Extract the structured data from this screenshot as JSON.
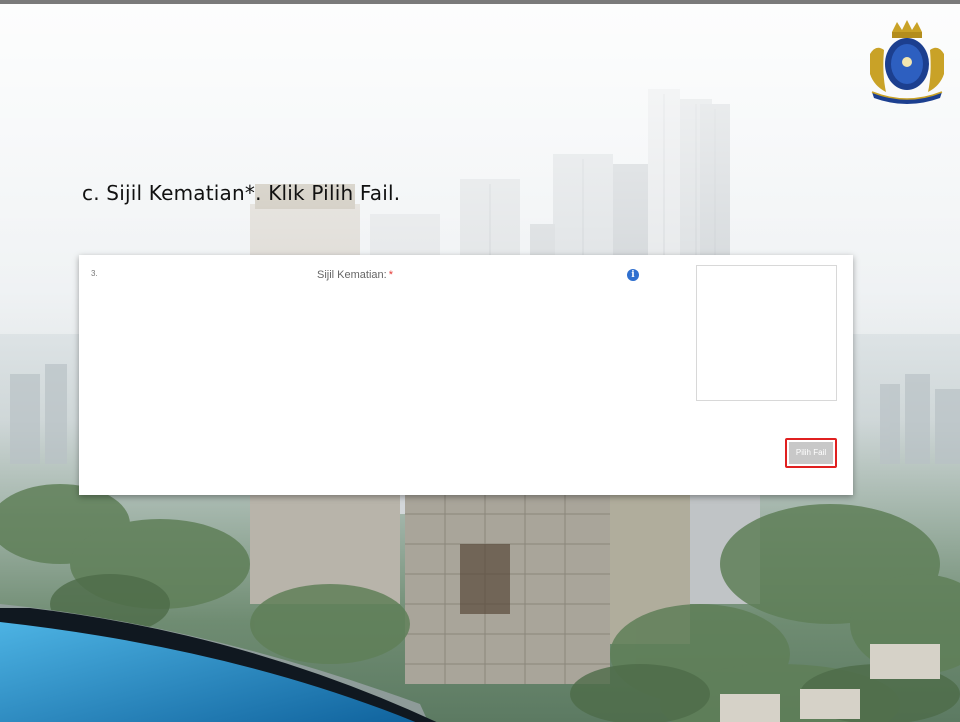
{
  "slide": {
    "instruction": "c. Sijil Kematian*. Klik Pilih Fail.",
    "crest": "state-crest-logo"
  },
  "form": {
    "row_number": "3.",
    "field_label": "Sijil Kematian:",
    "required_mark": "*",
    "info_icon": "info-icon",
    "info_glyph": "i",
    "choose_file_label": "Pilih Fail"
  },
  "colors": {
    "highlight_border": "#e02020",
    "info_icon": "#2f6fcf",
    "required": "#e53935",
    "accent_blue": "#1e7fbf"
  }
}
